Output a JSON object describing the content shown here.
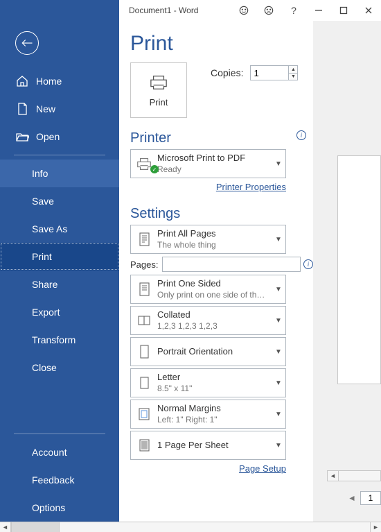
{
  "window": {
    "title": "Document1  -  Word"
  },
  "page": {
    "title": "Print"
  },
  "copies": {
    "label": "Copies:",
    "value": "1"
  },
  "print_tile": {
    "label": "Print"
  },
  "sidebar": {
    "home": "Home",
    "new": "New",
    "open": "Open",
    "info": "Info",
    "save": "Save",
    "save_as": "Save As",
    "print": "Print",
    "share": "Share",
    "export": "Export",
    "transform": "Transform",
    "close": "Close",
    "account": "Account",
    "feedback": "Feedback",
    "options": "Options"
  },
  "printer": {
    "heading": "Printer",
    "name": "Microsoft Print to PDF",
    "status": "Ready",
    "properties_link": "Printer Properties"
  },
  "settings": {
    "heading": "Settings",
    "scope": {
      "title": "Print All Pages",
      "sub": "The whole thing"
    },
    "pages_label": "Pages:",
    "pages_value": "",
    "sided": {
      "title": "Print One Sided",
      "sub": "Only print on one side of th…"
    },
    "collate": {
      "title": "Collated",
      "sub": "1,2,3    1,2,3    1,2,3"
    },
    "orientation": {
      "title": "Portrait Orientation"
    },
    "paper": {
      "title": "Letter",
      "sub": "8.5\" x 11\""
    },
    "margins": {
      "title": "Normal Margins",
      "sub": "Left:  1\"    Right:  1\""
    },
    "per_sheet": {
      "title": "1 Page Per Sheet"
    },
    "page_setup_link": "Page Setup"
  },
  "pager": {
    "current": "1"
  }
}
